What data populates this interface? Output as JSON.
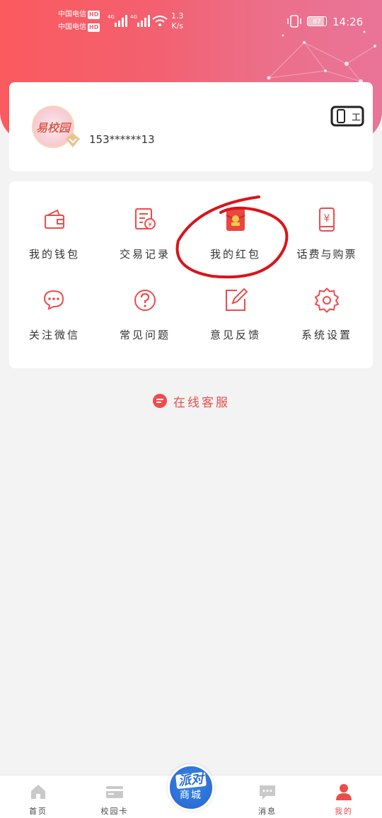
{
  "status_bar": {
    "carrier1": "中国电信",
    "carrier2": "中国电信",
    "hd_label": "HD",
    "network_type": "4G",
    "net_speed_value": "1.3",
    "net_speed_unit": "K/s",
    "battery": "87",
    "battery_level": 0.87,
    "time": "14:26"
  },
  "profile": {
    "avatar_logo": "易校园",
    "phone": "153******13",
    "card_icon_text": "工"
  },
  "menu": [
    {
      "label": "我的钱包",
      "icon": "wallet-icon"
    },
    {
      "label": "交易记录",
      "icon": "transaction-record-icon"
    },
    {
      "label": "我的红包",
      "icon": "red-packet-icon"
    },
    {
      "label": "话费与购票",
      "icon": "phone-ticket-icon"
    },
    {
      "label": "关注微信",
      "icon": "wechat-chat-icon"
    },
    {
      "label": "常见问题",
      "icon": "question-icon"
    },
    {
      "label": "意见反馈",
      "icon": "feedback-edit-icon"
    },
    {
      "label": "系统设置",
      "icon": "settings-gear-icon"
    }
  ],
  "service": {
    "label": "在线客服"
  },
  "tabs": [
    {
      "label": "首页",
      "icon": "home-icon"
    },
    {
      "label": "校园卡",
      "icon": "campus-card-icon"
    },
    {
      "label": "消息",
      "icon": "message-icon"
    },
    {
      "label": "我的",
      "icon": "profile-icon"
    }
  ],
  "party_mall": {
    "top": "派对",
    "bottom": "商城"
  },
  "colors": {
    "accent": "#ee4b4b",
    "header_start": "#fb5a5f",
    "header_end": "#e97498",
    "party_blue": "#2b6fd6"
  }
}
